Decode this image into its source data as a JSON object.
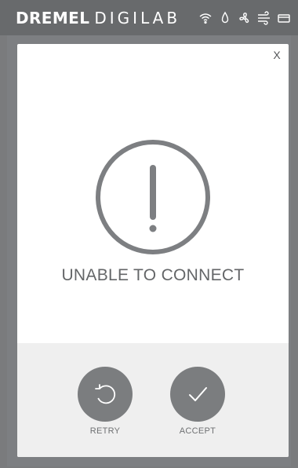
{
  "header": {
    "brand_primary": "DREMEL",
    "brand_secondary": "DIGILAB",
    "status_icons": [
      "wifi-icon",
      "filament-drop-icon",
      "fan-icon",
      "airflow-icon",
      "card-icon"
    ]
  },
  "dialog": {
    "close_label": "X",
    "icon": "alert-exclamation-icon",
    "message": "UNABLE TO CONNECT",
    "actions": [
      {
        "label": "RETRY",
        "icon": "retry-icon"
      },
      {
        "label": "ACCEPT",
        "icon": "checkmark-icon"
      }
    ]
  },
  "colors": {
    "topbar": "#686a6c",
    "background": "#7a7b7d",
    "dialog": "#ffffff",
    "action_bar": "#efefef",
    "button_circle": "#7b7d7f",
    "text": "#646668"
  }
}
